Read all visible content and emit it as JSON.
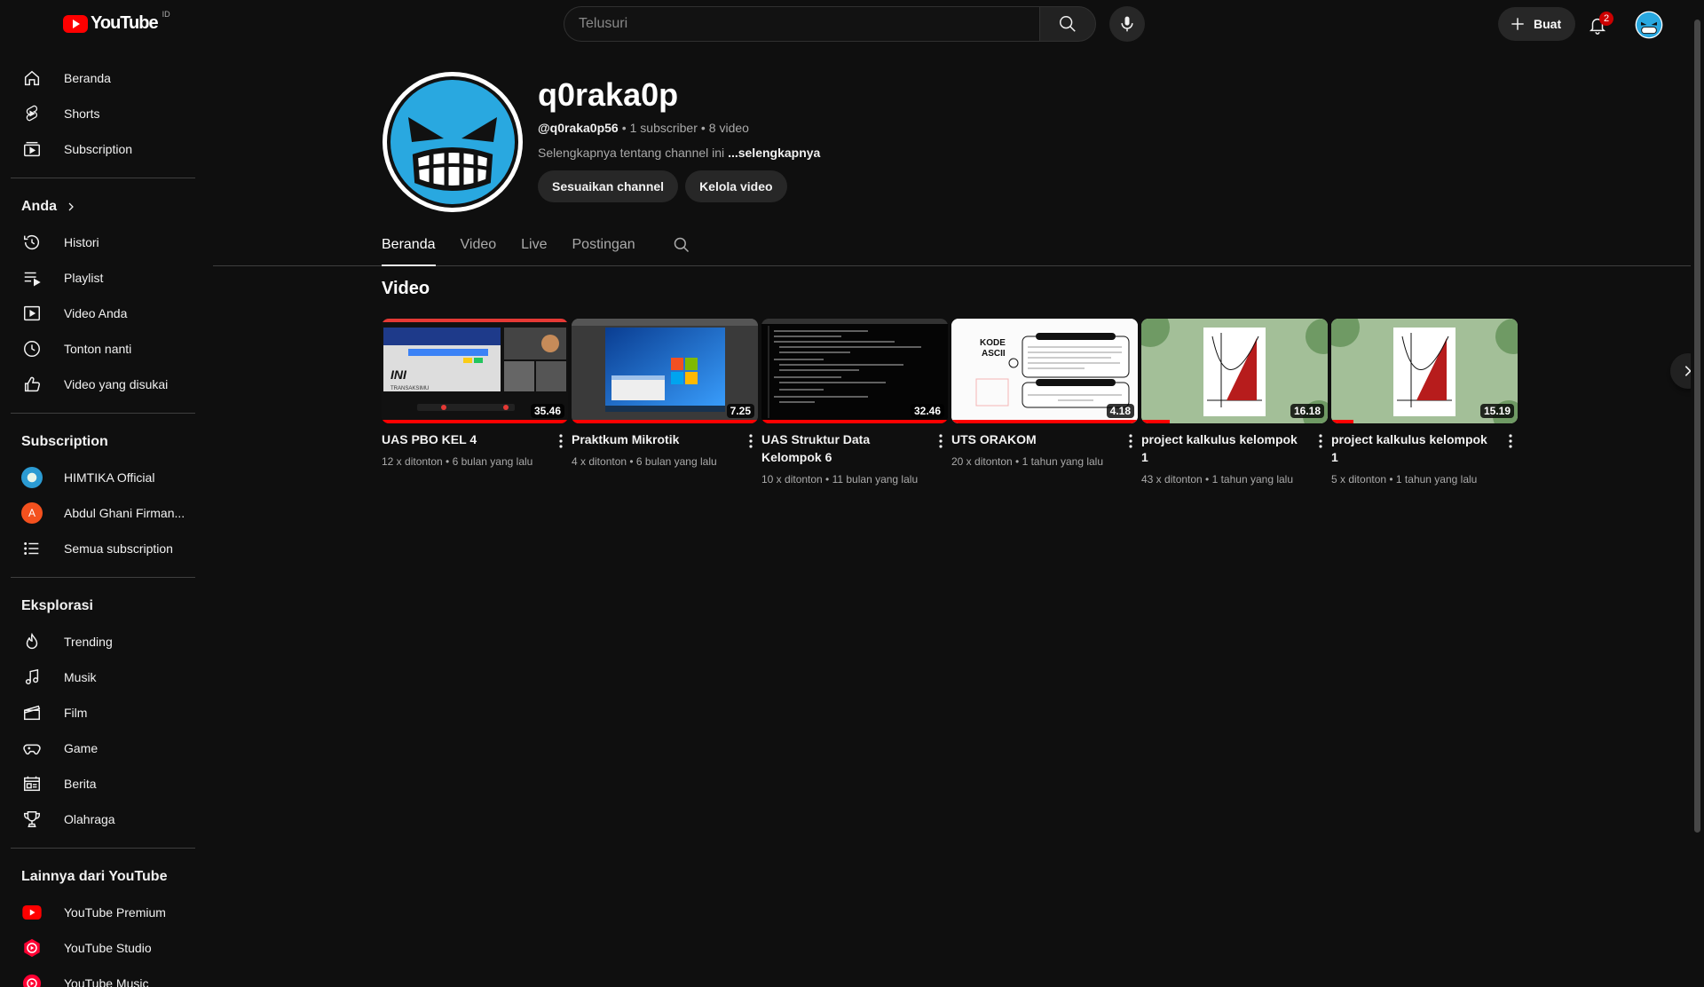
{
  "topbar": {
    "logo_text": "YouTube",
    "logo_region": "ID",
    "search_placeholder": "Telusuri",
    "create_label": "Buat",
    "notification_count": "2"
  },
  "sidebar": {
    "main_items": [
      {
        "label": "Beranda",
        "icon": "home-icon"
      },
      {
        "label": "Shorts",
        "icon": "shorts-icon"
      },
      {
        "label": "Subscription",
        "icon": "subscriptions-icon"
      }
    ],
    "you_heading": "Anda",
    "you_items": [
      {
        "label": "Histori",
        "icon": "history-icon"
      },
      {
        "label": "Playlist",
        "icon": "playlist-icon"
      },
      {
        "label": "Video Anda",
        "icon": "your-videos-icon"
      },
      {
        "label": "Tonton nanti",
        "icon": "watch-later-icon"
      },
      {
        "label": "Video yang disukai",
        "icon": "liked-icon"
      }
    ],
    "subscription_heading": "Subscription",
    "subscription_items": [
      {
        "label": "HIMTIKA Official",
        "avatar": "",
        "color": "#2b9bd3"
      },
      {
        "label": "Abdul Ghani Firman...",
        "avatar": "A",
        "color": "#f4511e"
      },
      {
        "label": "Semua subscription",
        "icon": "list-icon"
      }
    ],
    "explore_heading": "Eksplorasi",
    "explore_items": [
      {
        "label": "Trending",
        "icon": "trending-icon"
      },
      {
        "label": "Musik",
        "icon": "music-icon"
      },
      {
        "label": "Film",
        "icon": "film-icon"
      },
      {
        "label": "Game",
        "icon": "gaming-icon"
      },
      {
        "label": "Berita",
        "icon": "news-icon"
      },
      {
        "label": "Olahraga",
        "icon": "sports-icon"
      }
    ],
    "more_heading": "Lainnya dari YouTube",
    "more_items": [
      {
        "label": "YouTube Premium",
        "icon": "yt-premium-icon"
      },
      {
        "label": "YouTube Studio",
        "icon": "yt-studio-icon"
      },
      {
        "label": "YouTube Music",
        "icon": "yt-music-icon"
      }
    ]
  },
  "channel": {
    "name": "q0raka0p",
    "handle": "@q0raka0p56",
    "subscribers": "1 subscriber",
    "video_count": "8 video",
    "separator": "•",
    "description": "Selengkapnya tentang channel ini",
    "more_link": "...selengkapnya",
    "customize_label": "Sesuaikan channel",
    "manage_label": "Kelola video"
  },
  "tabs": [
    "Beranda",
    "Video",
    "Live",
    "Postingan"
  ],
  "section_title": "Video",
  "videos": [
    {
      "title": "UAS PBO KEL 4",
      "duration": "35.46",
      "views": "12 x ditonton",
      "age": "6 bulan yang lalu",
      "progress": 1.0,
      "thumb_style": "screenshare"
    },
    {
      "title": "Praktkum Mikrotik",
      "duration": "7.25",
      "views": "4 x ditonton",
      "age": "6 bulan yang lalu",
      "progress": 1.0,
      "thumb_style": "windows"
    },
    {
      "title": "UAS Struktur Data Kelompok 6",
      "duration": "32.46",
      "views": "10 x ditonton",
      "age": "11 bulan yang lalu",
      "progress": 1.0,
      "thumb_style": "code"
    },
    {
      "title": "UTS ORAKOM",
      "duration": "4.18",
      "views": "20 x ditonton",
      "age": "1 tahun yang lalu",
      "progress": 1.0,
      "thumb_style": "slides"
    },
    {
      "title": "project kalkulus kelompok 1",
      "duration": "16.18",
      "views": "43 x ditonton",
      "age": "1 tahun yang lalu",
      "progress": 0.15,
      "thumb_style": "graph"
    },
    {
      "title": "project kalkulus kelompok 1",
      "duration": "15.19",
      "views": "5 x ditonton",
      "age": "1 tahun yang lalu",
      "progress": 0.12,
      "thumb_style": "graph"
    }
  ]
}
